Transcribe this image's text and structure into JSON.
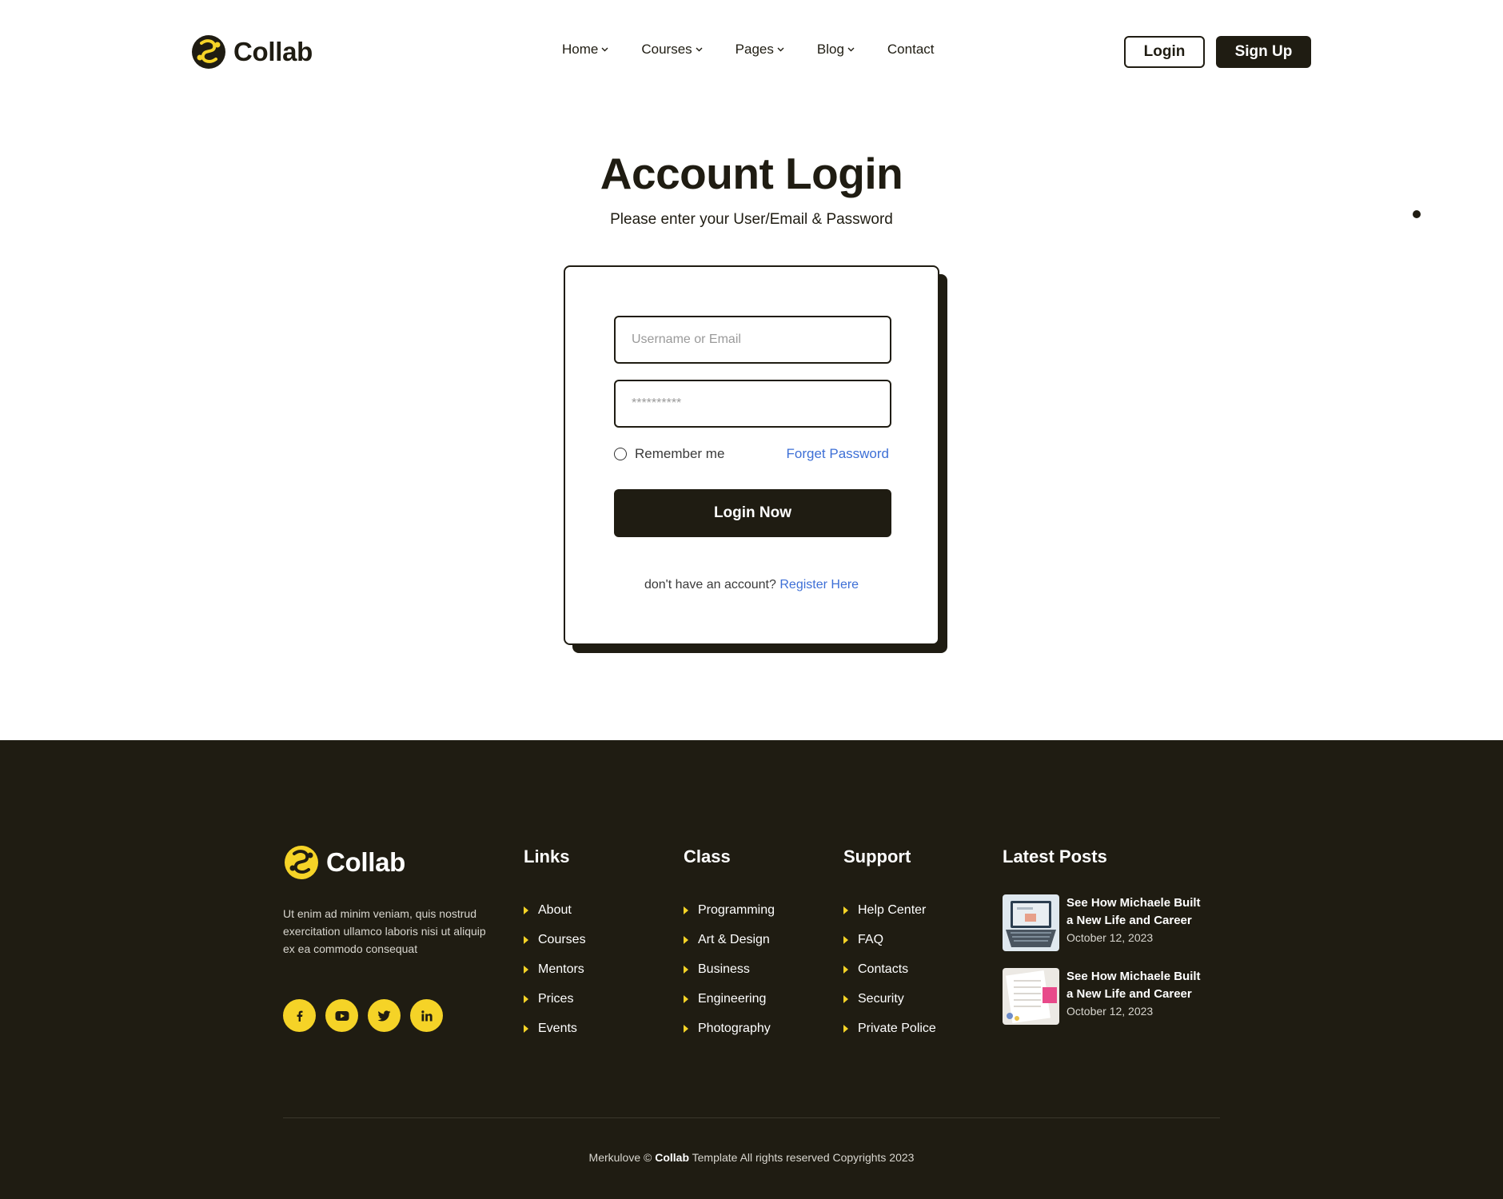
{
  "brand": {
    "name": "Collab",
    "accent": "#f5d327",
    "dark": "#1f1c12",
    "link": "#3d6fd6"
  },
  "nav": {
    "items": [
      {
        "label": "Home",
        "has_dropdown": true
      },
      {
        "label": "Courses",
        "has_dropdown": true
      },
      {
        "label": "Pages",
        "has_dropdown": true
      },
      {
        "label": "Blog",
        "has_dropdown": true
      },
      {
        "label": "Contact",
        "has_dropdown": false
      }
    ],
    "login_label": "Login",
    "signup_label": "Sign Up"
  },
  "login": {
    "title": "Account Login",
    "subtitle": "Please enter your User/Email & Password",
    "username_placeholder": "Username or Email",
    "password_placeholder": "**********",
    "remember_label": "Remember me",
    "forget_label": "Forget Password",
    "submit_label": "Login Now",
    "register_prompt": "don't have an account?",
    "register_link": "Register Here"
  },
  "footer": {
    "brand_name": "Collab",
    "description": "Ut enim ad minim veniam, quis nostrud exercitation ullamco laboris nisi ut aliquip ex ea commodo consequat",
    "socials": [
      "facebook-icon",
      "youtube-icon",
      "twitter-icon",
      "linkedin-icon"
    ],
    "columns": [
      {
        "title": "Links",
        "items": [
          "About",
          "Courses",
          "Mentors",
          "Prices",
          "Events"
        ]
      },
      {
        "title": "Class",
        "items": [
          "Programming",
          "Art & Design",
          "Business",
          "Engineering",
          "Photography"
        ]
      },
      {
        "title": "Support",
        "items": [
          "Help Center",
          "FAQ",
          "Contacts",
          "Security",
          "Private Police"
        ]
      }
    ],
    "latest_posts": {
      "title": "Latest Posts",
      "posts": [
        {
          "title": "See How Michaele Built a New Life and Career",
          "date": "October 12, 2023"
        },
        {
          "title": "See How Michaele Built a New Life and Career",
          "date": "October 12, 2023"
        }
      ]
    },
    "copyright": {
      "prefix": "Merkulove ©",
      "brand": "Collab",
      "suffix": "Template All rights reserved Copyrights 2023"
    }
  }
}
